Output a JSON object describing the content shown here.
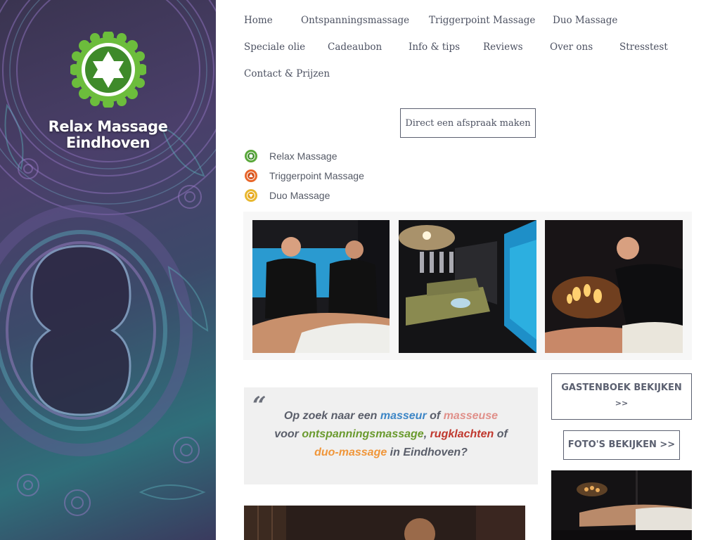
{
  "brand": {
    "line1": "Relax Massage",
    "line2": "Eindhoven"
  },
  "nav": {
    "items": [
      "Home",
      "Ontspanningsmassage",
      "Triggerpoint Massage",
      "Duo Massage",
      "Speciale olie",
      "Cadeaubon",
      "Info & tips",
      "Reviews",
      "Over ons",
      "Stresstest",
      "Contact & Prijzen"
    ]
  },
  "cta_label": "Direct een afspraak maken",
  "services": [
    {
      "label": "Relax Massage",
      "color": "#5aa83a"
    },
    {
      "label": "Triggerpoint Massage",
      "color": "#e8662a"
    },
    {
      "label": "Duo Massage",
      "color": "#e8b830"
    }
  ],
  "quote": {
    "mark": "“",
    "line1": {
      "a": "Op zoek naar een ",
      "b": "masseur",
      "c": " of ",
      "d": "masseuse"
    },
    "line2": {
      "a": "voor ",
      "b": "ontspanningsmassage",
      "c": ", ",
      "d": "rugklachten",
      "e": " of"
    },
    "line3": {
      "a": "duo-massage",
      "b": " in Eindhoven?"
    }
  },
  "colors": {
    "masseur": "#3d86c6",
    "masseuse": "#e0908a",
    "ontspanning": "#6a9a2e",
    "rugklachten": "#c0382e",
    "duo": "#f0963a"
  },
  "guestbook": {
    "line1": "GASTENBOEK BEKIJKEN",
    "line2": ">>"
  },
  "photos_label": "FOTO'S BEKIJKEN >>"
}
